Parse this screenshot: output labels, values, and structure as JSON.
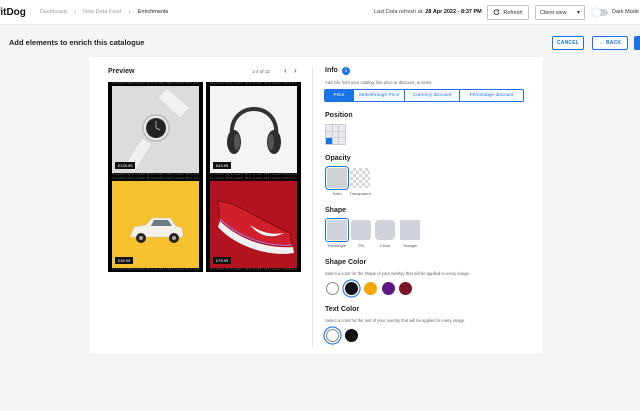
{
  "app": {
    "logo": "fitDog"
  },
  "breadcrumb": {
    "items": [
      "Dashboard",
      "New Data Feed",
      "Enrichments"
    ]
  },
  "topbar": {
    "refresh_prefix": "Last Data refresh at:",
    "refresh_time": "28 Apr 2022 - 8:37 PM",
    "refresh_label": "Refresh",
    "view_select": "Client view",
    "dark_mode_label": "Dark Mode"
  },
  "header": {
    "title": "Add elements to enrich this catalogue",
    "cancel_label": "CANCEL",
    "back_label": "BACK"
  },
  "preview": {
    "title": "Preview",
    "pager": "1-4 of 12",
    "strip_text": "PETS CLASSY PETS CLASSY PETS CLASSY PETS CLASSY PETS CLASSY PETS CLASSY",
    "tiles": [
      {
        "subject": "watch",
        "price": "£129.99"
      },
      {
        "subject": "headphones",
        "price": "£44.99"
      },
      {
        "subject": "car",
        "price": "£39.99"
      },
      {
        "subject": "sneaker",
        "price": "£79.99"
      }
    ]
  },
  "info": {
    "title": "Info",
    "description": "Add info from your catalog, like price or discount, to items",
    "tabs": [
      "Price",
      "Strikethrough Price",
      "Currency discount",
      "Percentage discount"
    ],
    "active_tab": "Price"
  },
  "position": {
    "title": "Position",
    "selected_cell": "bottom-left"
  },
  "opacity": {
    "title": "Opacity",
    "options": [
      "Solid",
      "Transparent"
    ],
    "selected": "Solid"
  },
  "shape": {
    "title": "Shape",
    "options": [
      "Rectangle",
      "Pill",
      "Circle",
      "Triangle"
    ],
    "selected": "Rectangle"
  },
  "shape_color": {
    "title": "Shape Color",
    "description": "Select a color for the shape of your overlay that will be applied to every image.",
    "colors": [
      "#ffffff",
      "#111111",
      "#f6a607",
      "#5b1a86",
      "#7a1625"
    ],
    "selected": "#111111"
  },
  "text_color": {
    "title": "Text Color",
    "description": "Select a color for the text of your overlay that will be applied to every image.",
    "colors": [
      "#ffffff",
      "#111111"
    ],
    "selected": "#ffffff"
  },
  "accent": "#1a73e8"
}
